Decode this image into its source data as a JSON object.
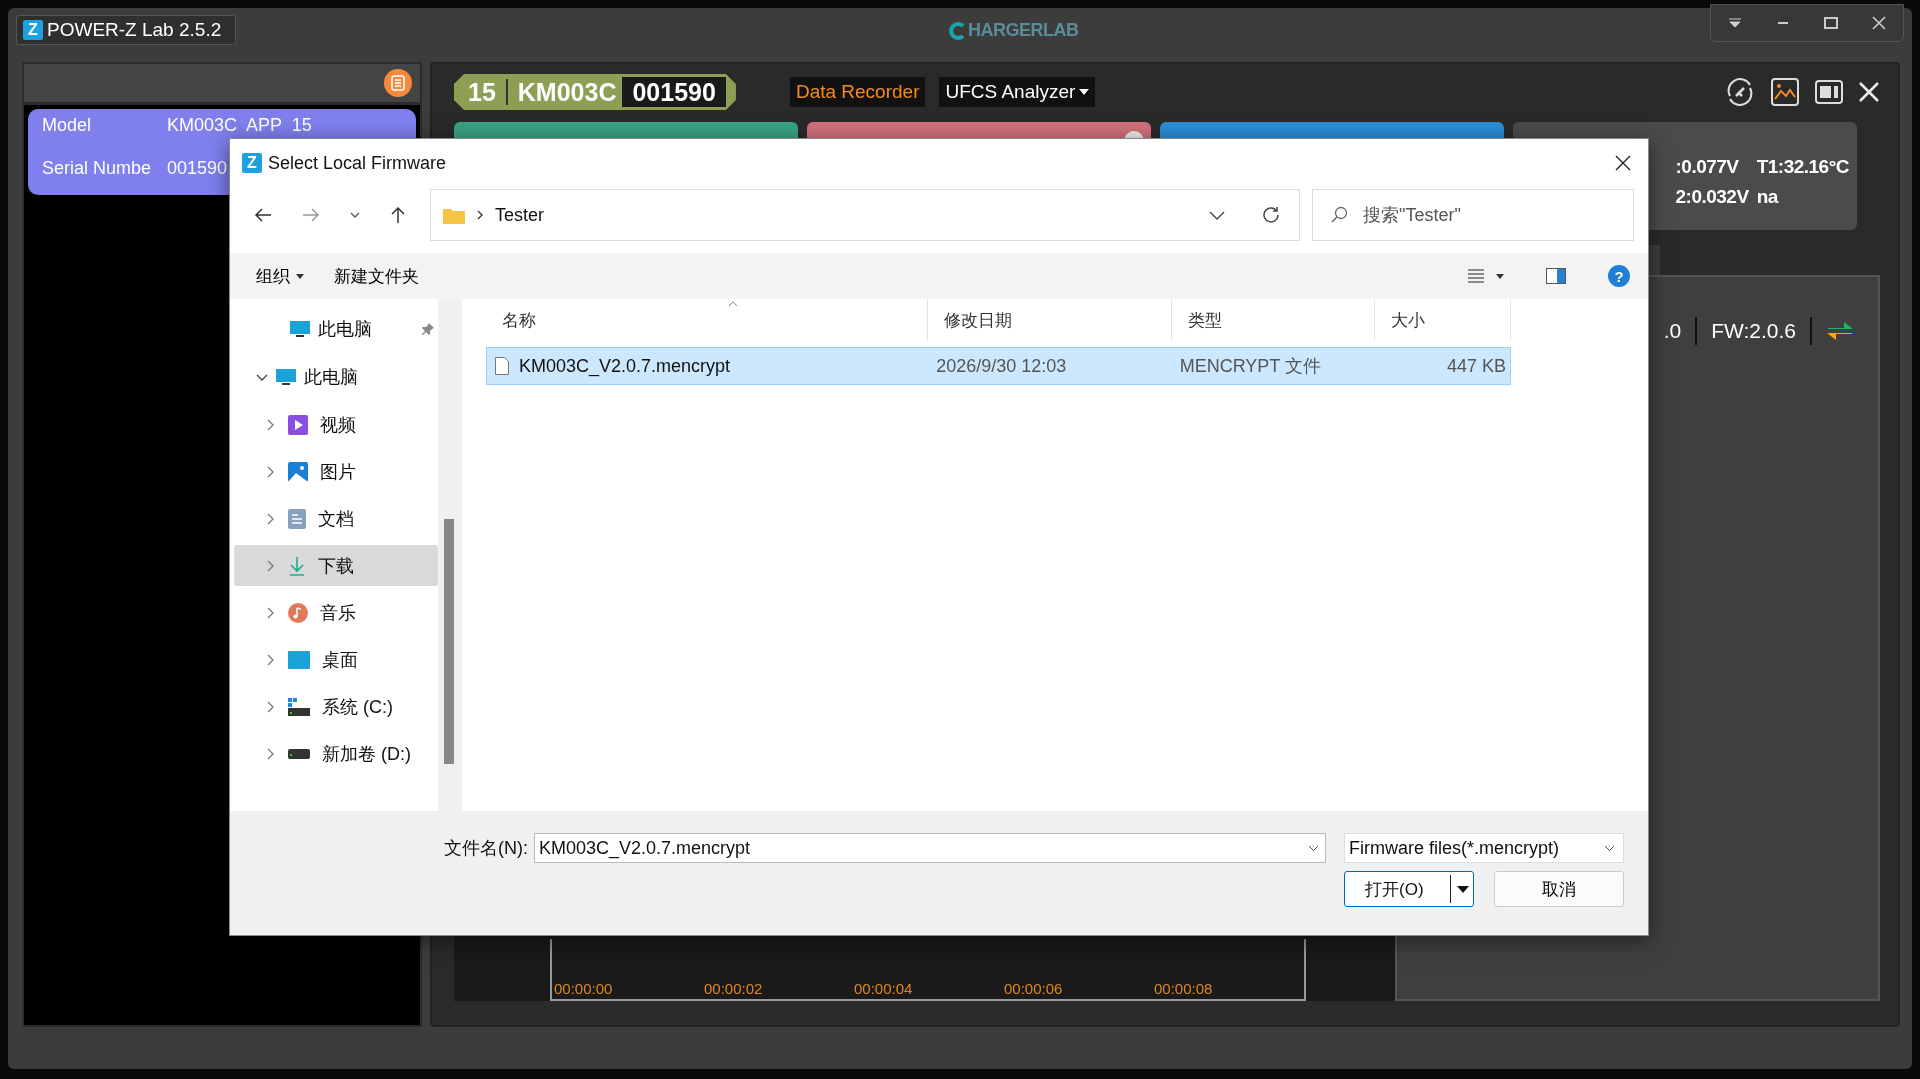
{
  "app": {
    "logo_letter": "Z",
    "title": "POWER-Z Lab 2.5.2",
    "brand": "HARGERLAB"
  },
  "device_card": {
    "rows": [
      {
        "label": "Model",
        "value": "KM003C  APP  15"
      },
      {
        "label": "Serial Numbe",
        "value": "001590"
      }
    ]
  },
  "header": {
    "channel": "15",
    "model": "KM003C",
    "serial": "001590",
    "tabs": [
      {
        "label": "Data Recorder",
        "selected": true
      },
      {
        "label": "UFCS Analyzer",
        "selected": false
      }
    ]
  },
  "tiles": [
    {
      "kind": "plain",
      "color": "#3aa385"
    },
    {
      "kind": "plain",
      "color": "#d1717d"
    },
    {
      "kind": "plain",
      "color": "#2b8fd8"
    },
    {
      "kind": "readings",
      "color": "#4b4b4b",
      "readings": [
        ":0.077V",
        "T1:32.16°C",
        "2:0.032V",
        "na"
      ]
    }
  ],
  "info_panel": {
    "fields": [
      ".0",
      "FW:2.0.6"
    ]
  },
  "timeline": {
    "ticks": [
      "00:00:00",
      "00:00:02",
      "00:00:04",
      "00:00:06",
      "00:00:08"
    ]
  },
  "dialog": {
    "logo_letter": "Z",
    "title": "Select Local Firmware",
    "help": "?",
    "address": {
      "path": "Tester",
      "search_placeholder": "搜索\"Tester\""
    },
    "toolbar": {
      "organize": "组织",
      "new_folder": "新建文件夹"
    },
    "quick_access": [
      {
        "label": "此电脑",
        "pinned": true
      }
    ],
    "tree": [
      {
        "label": "此电脑",
        "kind": "computer",
        "expanded": true,
        "selected": false,
        "children": [
          {
            "label": "视频",
            "kind": "video",
            "expanded": false,
            "selected": false
          },
          {
            "label": "图片",
            "kind": "pictures",
            "expanded": false,
            "selected": false
          },
          {
            "label": "文档",
            "kind": "documents",
            "expanded": false,
            "selected": false
          },
          {
            "label": "下载",
            "kind": "downloads",
            "expanded": false,
            "selected": true
          },
          {
            "label": "音乐",
            "kind": "music",
            "expanded": false,
            "selected": false
          },
          {
            "label": "桌面",
            "kind": "desktop",
            "expanded": false,
            "selected": false
          },
          {
            "label": "系统 (C:)",
            "kind": "system-drive",
            "expanded": false,
            "selected": false
          },
          {
            "label": "新加卷 (D:)",
            "kind": "drive",
            "expanded": false,
            "selected": false
          }
        ]
      }
    ],
    "columns": [
      "名称",
      "修改日期",
      "类型",
      "大小"
    ],
    "files": [
      {
        "name": "KM003C_V2.0.7.mencrypt",
        "modified": "2026/9/30 12:03",
        "type": "MENCRYPT 文件",
        "size": "447 KB",
        "selected": true
      }
    ],
    "filename_label": "文件名(N):",
    "filename": "KM003C_V2.0.7.mencrypt",
    "filter": "Firmware files(*.mencrypt)",
    "buttons": [
      {
        "kind": "open",
        "label": "打开(O)"
      },
      {
        "kind": "cancel",
        "label": "取消"
      }
    ]
  }
}
